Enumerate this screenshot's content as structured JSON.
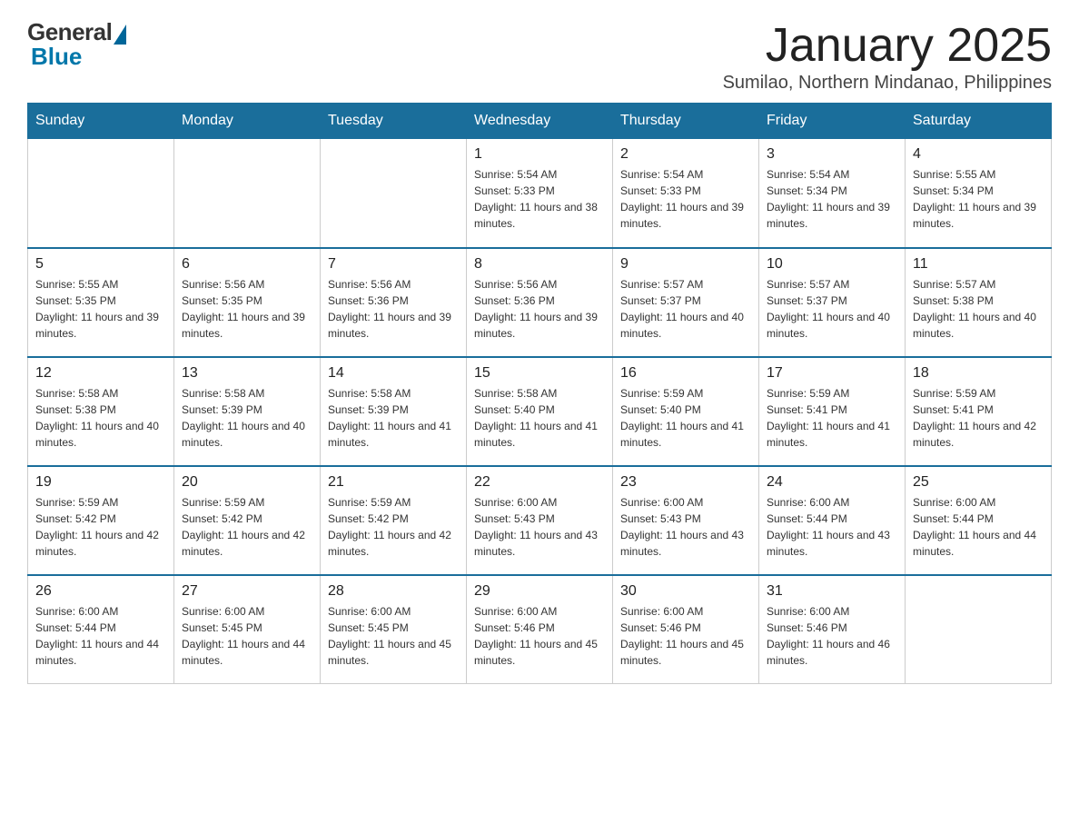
{
  "header": {
    "title": "January 2025",
    "location": "Sumilao, Northern Mindanao, Philippines",
    "logo_general": "General",
    "logo_blue": "Blue"
  },
  "days_of_week": [
    "Sunday",
    "Monday",
    "Tuesday",
    "Wednesday",
    "Thursday",
    "Friday",
    "Saturday"
  ],
  "weeks": [
    [
      {
        "day": "",
        "info": ""
      },
      {
        "day": "",
        "info": ""
      },
      {
        "day": "",
        "info": ""
      },
      {
        "day": "1",
        "info": "Sunrise: 5:54 AM\nSunset: 5:33 PM\nDaylight: 11 hours and 38 minutes."
      },
      {
        "day": "2",
        "info": "Sunrise: 5:54 AM\nSunset: 5:33 PM\nDaylight: 11 hours and 39 minutes."
      },
      {
        "day": "3",
        "info": "Sunrise: 5:54 AM\nSunset: 5:34 PM\nDaylight: 11 hours and 39 minutes."
      },
      {
        "day": "4",
        "info": "Sunrise: 5:55 AM\nSunset: 5:34 PM\nDaylight: 11 hours and 39 minutes."
      }
    ],
    [
      {
        "day": "5",
        "info": "Sunrise: 5:55 AM\nSunset: 5:35 PM\nDaylight: 11 hours and 39 minutes."
      },
      {
        "day": "6",
        "info": "Sunrise: 5:56 AM\nSunset: 5:35 PM\nDaylight: 11 hours and 39 minutes."
      },
      {
        "day": "7",
        "info": "Sunrise: 5:56 AM\nSunset: 5:36 PM\nDaylight: 11 hours and 39 minutes."
      },
      {
        "day": "8",
        "info": "Sunrise: 5:56 AM\nSunset: 5:36 PM\nDaylight: 11 hours and 39 minutes."
      },
      {
        "day": "9",
        "info": "Sunrise: 5:57 AM\nSunset: 5:37 PM\nDaylight: 11 hours and 40 minutes."
      },
      {
        "day": "10",
        "info": "Sunrise: 5:57 AM\nSunset: 5:37 PM\nDaylight: 11 hours and 40 minutes."
      },
      {
        "day": "11",
        "info": "Sunrise: 5:57 AM\nSunset: 5:38 PM\nDaylight: 11 hours and 40 minutes."
      }
    ],
    [
      {
        "day": "12",
        "info": "Sunrise: 5:58 AM\nSunset: 5:38 PM\nDaylight: 11 hours and 40 minutes."
      },
      {
        "day": "13",
        "info": "Sunrise: 5:58 AM\nSunset: 5:39 PM\nDaylight: 11 hours and 40 minutes."
      },
      {
        "day": "14",
        "info": "Sunrise: 5:58 AM\nSunset: 5:39 PM\nDaylight: 11 hours and 41 minutes."
      },
      {
        "day": "15",
        "info": "Sunrise: 5:58 AM\nSunset: 5:40 PM\nDaylight: 11 hours and 41 minutes."
      },
      {
        "day": "16",
        "info": "Sunrise: 5:59 AM\nSunset: 5:40 PM\nDaylight: 11 hours and 41 minutes."
      },
      {
        "day": "17",
        "info": "Sunrise: 5:59 AM\nSunset: 5:41 PM\nDaylight: 11 hours and 41 minutes."
      },
      {
        "day": "18",
        "info": "Sunrise: 5:59 AM\nSunset: 5:41 PM\nDaylight: 11 hours and 42 minutes."
      }
    ],
    [
      {
        "day": "19",
        "info": "Sunrise: 5:59 AM\nSunset: 5:42 PM\nDaylight: 11 hours and 42 minutes."
      },
      {
        "day": "20",
        "info": "Sunrise: 5:59 AM\nSunset: 5:42 PM\nDaylight: 11 hours and 42 minutes."
      },
      {
        "day": "21",
        "info": "Sunrise: 5:59 AM\nSunset: 5:42 PM\nDaylight: 11 hours and 42 minutes."
      },
      {
        "day": "22",
        "info": "Sunrise: 6:00 AM\nSunset: 5:43 PM\nDaylight: 11 hours and 43 minutes."
      },
      {
        "day": "23",
        "info": "Sunrise: 6:00 AM\nSunset: 5:43 PM\nDaylight: 11 hours and 43 minutes."
      },
      {
        "day": "24",
        "info": "Sunrise: 6:00 AM\nSunset: 5:44 PM\nDaylight: 11 hours and 43 minutes."
      },
      {
        "day": "25",
        "info": "Sunrise: 6:00 AM\nSunset: 5:44 PM\nDaylight: 11 hours and 44 minutes."
      }
    ],
    [
      {
        "day": "26",
        "info": "Sunrise: 6:00 AM\nSunset: 5:44 PM\nDaylight: 11 hours and 44 minutes."
      },
      {
        "day": "27",
        "info": "Sunrise: 6:00 AM\nSunset: 5:45 PM\nDaylight: 11 hours and 44 minutes."
      },
      {
        "day": "28",
        "info": "Sunrise: 6:00 AM\nSunset: 5:45 PM\nDaylight: 11 hours and 45 minutes."
      },
      {
        "day": "29",
        "info": "Sunrise: 6:00 AM\nSunset: 5:46 PM\nDaylight: 11 hours and 45 minutes."
      },
      {
        "day": "30",
        "info": "Sunrise: 6:00 AM\nSunset: 5:46 PM\nDaylight: 11 hours and 45 minutes."
      },
      {
        "day": "31",
        "info": "Sunrise: 6:00 AM\nSunset: 5:46 PM\nDaylight: 11 hours and 46 minutes."
      },
      {
        "day": "",
        "info": ""
      }
    ]
  ]
}
